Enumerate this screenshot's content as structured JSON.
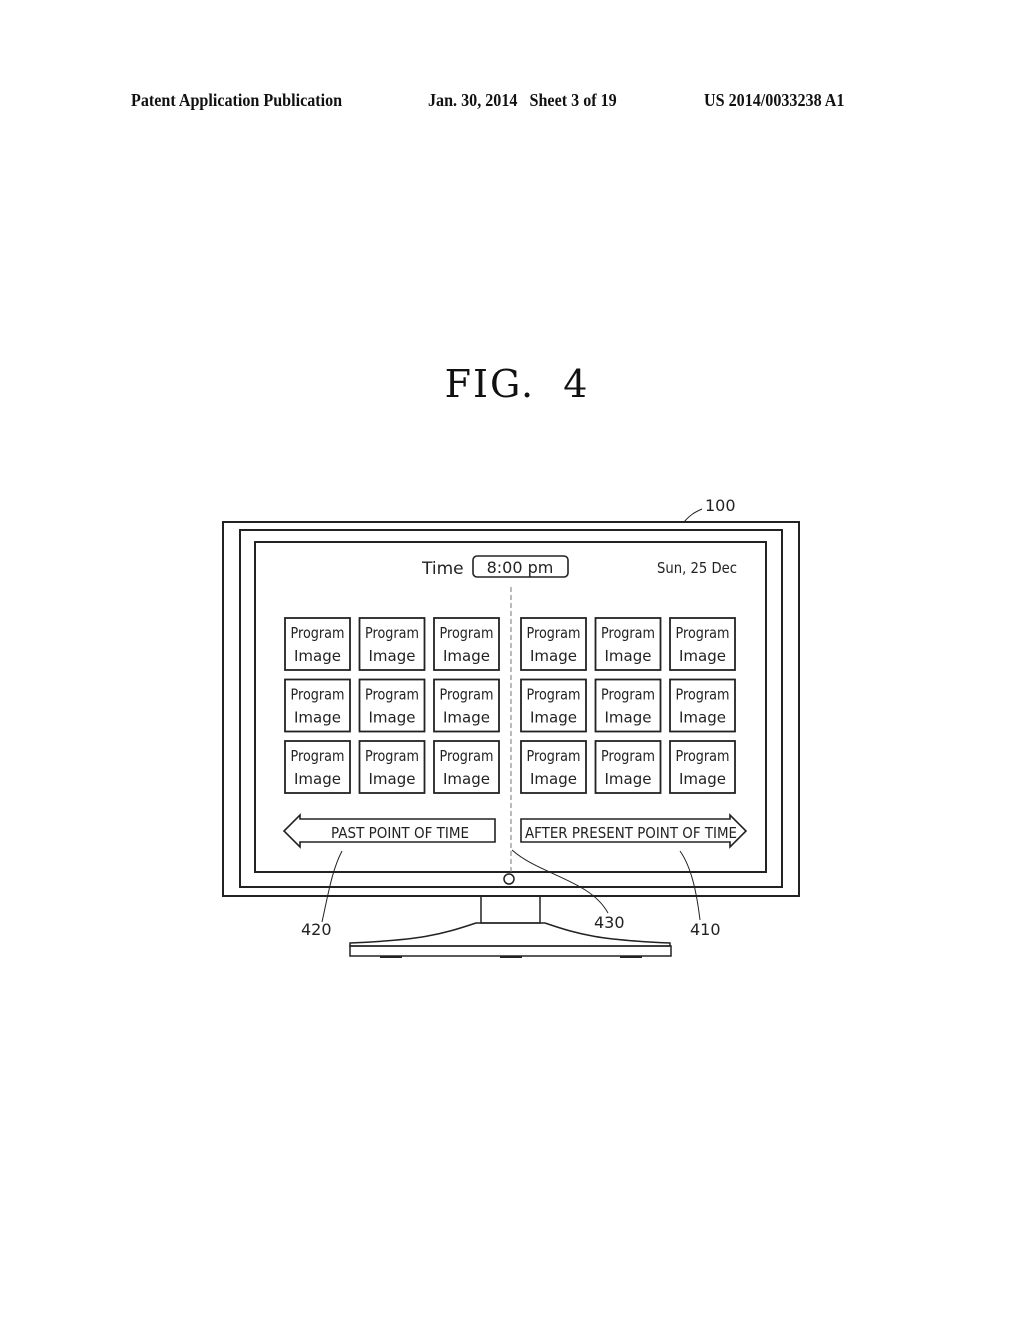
{
  "header": {
    "publication": "Patent Application Publication",
    "date_sheet": "Jan. 30, 2014   Sheet 3 of 19",
    "number": "US 2014/0033238 A1"
  },
  "figure": {
    "title": "FIG.  4",
    "screen": {
      "time_label": "Time",
      "time_value": "8:00 pm",
      "date": "Sun, 25 Dec",
      "tile_line1": "Program",
      "tile_line2": "Image",
      "left_grid": {
        "rows": 3,
        "cols": 3
      },
      "right_grid": {
        "rows": 3,
        "cols": 3
      },
      "past_arrow": "PAST POINT OF TIME",
      "future_arrow": "AFTER PRESENT POINT OF TIME"
    },
    "reference_numerals": {
      "tv": "100",
      "future": "410",
      "past": "420",
      "divider": "430"
    }
  }
}
